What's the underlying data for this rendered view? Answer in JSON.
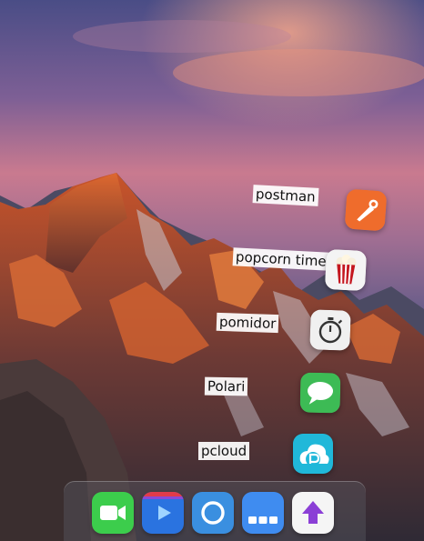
{
  "launcher": {
    "items": [
      {
        "label": "postman",
        "icon": "postman-icon",
        "color": "#ef6c2c"
      },
      {
        "label": "popcorn time",
        "icon": "popcorn-time-icon",
        "color": "#b3141c"
      },
      {
        "label": "pomidor",
        "icon": "pomidor-timer-icon",
        "color": "#f2f2f2"
      },
      {
        "label": "Polari",
        "icon": "polari-chat-icon",
        "color": "#3dbb55"
      },
      {
        "label": "pcloud",
        "icon": "pcloud-icon",
        "color": "#20b8d9"
      }
    ]
  },
  "dock": {
    "items": [
      {
        "icon": "facetime-icon",
        "color": "#3ccd4c"
      },
      {
        "icon": "media-player-icon",
        "color": "#2a73e0"
      },
      {
        "icon": "circle-browser-icon",
        "color": "#3a8fe0"
      },
      {
        "icon": "workspace-switcher-icon",
        "color": "#3f8cf0"
      },
      {
        "icon": "upload-arrow-icon",
        "color": "#8b3fd6"
      }
    ]
  }
}
